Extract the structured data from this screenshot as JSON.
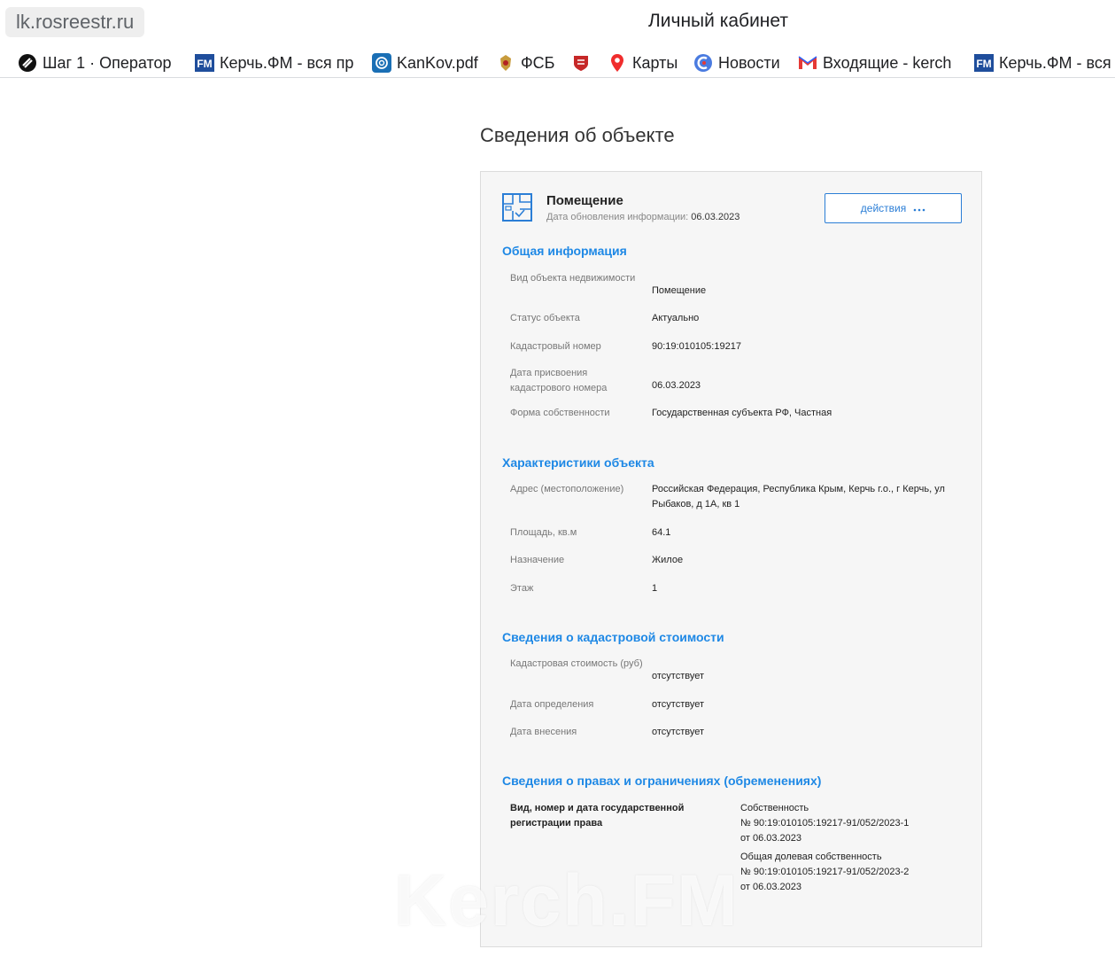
{
  "browser": {
    "url": "lk.rosreestr.ru",
    "title": "Личный кабинет",
    "bookmarks": [
      {
        "label": "Шаг 1 · Оператор",
        "icon": "step-logo-icon"
      },
      {
        "label": "Керчь.ФМ - вся пр",
        "icon": "fm-logo-icon"
      },
      {
        "label": "KanKov.pdf",
        "icon": "openai-logo-icon"
      },
      {
        "label": "ФСБ",
        "icon": "fsb-emblem-icon"
      },
      {
        "label": "",
        "icon": "crimea-emblem-icon"
      },
      {
        "label": "Карты",
        "icon": "map-pin-icon"
      },
      {
        "label": "Новости",
        "icon": "news-icon"
      },
      {
        "label": "Входящие - kerch",
        "icon": "mail-icon"
      },
      {
        "label": "Керчь.ФМ - вся",
        "icon": "fm-logo-icon"
      }
    ]
  },
  "page": {
    "title": "Сведения об объекте"
  },
  "object": {
    "type": "Помещение",
    "date_label": "Дата обновления информации:",
    "date_value": "06.03.2023",
    "actions_label": "действия",
    "actions_icon": "more-dots-icon"
  },
  "sections": {
    "general": {
      "title": "Общая информация",
      "rows": [
        {
          "label": "Вид объекта недвижимости",
          "value": "Помещение"
        },
        {
          "label": "Статус объекта",
          "value": "Актуально"
        },
        {
          "label": "Кадастровый номер",
          "value": "90:19:010105:19217"
        },
        {
          "label": "Дата присвоения кадастрового номера",
          "value": "06.03.2023"
        },
        {
          "label": "Форма собственности",
          "value": "Государственная субъекта РФ, Частная"
        }
      ]
    },
    "characteristics": {
      "title": "Характеристики объекта",
      "rows": [
        {
          "label": "Адрес (местоположение)",
          "value": "Российская Федерация, Республика Крым, Керчь г.о., г Керчь, ул Рыбаков, д 1А, кв 1"
        },
        {
          "label": "Площадь, кв.м",
          "value": "64.1"
        },
        {
          "label": "Назначение",
          "value": "Жилое"
        },
        {
          "label": "Этаж",
          "value": "1"
        }
      ]
    },
    "cadastral_value": {
      "title": "Сведения о кадастровой стоимости",
      "rows": [
        {
          "label": "Кадастровая стоимость (руб)",
          "value": "отсутствует"
        },
        {
          "label": "Дата определения",
          "value": "отсутствует"
        },
        {
          "label": "Дата внесения",
          "value": "отсутствует"
        }
      ]
    },
    "rights": {
      "title": "Сведения о правах и ограничениях (обременениях)",
      "label": "Вид, номер и дата государственной регистрации права",
      "entries": [
        {
          "kind": "Собственность",
          "number": "№ 90:19:010105:19217-91/052/2023-1",
          "date": "от 06.03.2023"
        },
        {
          "kind": "Общая долевая собственность",
          "number": "№ 90:19:010105:19217-91/052/2023-2",
          "date": "от 06.03.2023"
        }
      ]
    }
  },
  "watermark": "Kerch.FM",
  "colors": {
    "accent": "#1e88e5",
    "card_bg": "#f6f6f6"
  }
}
